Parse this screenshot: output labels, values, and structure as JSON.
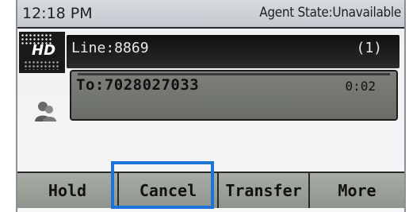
{
  "status": {
    "time": "12:18 PM",
    "agent_state": "Agent State:Unavailable"
  },
  "line": {
    "label": "Line:8869",
    "count": "(1)"
  },
  "call": {
    "to": "To:7028027033",
    "duration": "0:02"
  },
  "softkeys": {
    "hold": "Hold",
    "cancel": "Cancel",
    "transfer": "Transfer",
    "more": "More"
  },
  "highlight": {
    "target": "Cancel",
    "color": "#1e73d8"
  },
  "icons": [
    "hd-voice-icon",
    "contact-icon"
  ]
}
